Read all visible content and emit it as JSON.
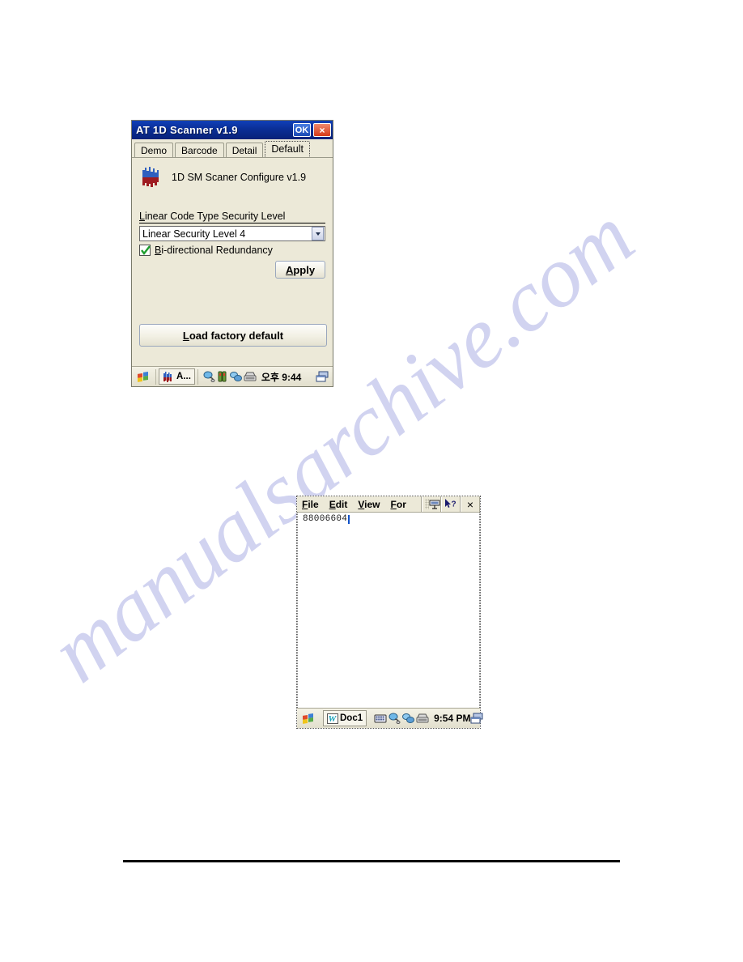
{
  "page": {
    "watermark": "manualsarchive.com",
    "background_color": "#ffffff",
    "rule_color": "#000000"
  },
  "scanner_window": {
    "title": "AT 1D Scanner v1.9",
    "titlebar_color": "#0a2e96",
    "ok_button": "OK",
    "close_button": "×",
    "tabs": [
      {
        "label": "Demo",
        "active": false
      },
      {
        "label": "Barcode",
        "active": false
      },
      {
        "label": "Detail",
        "active": false
      },
      {
        "label": "Default",
        "active": true
      }
    ],
    "brand_text": "1D SM Scaner Configure v1.9",
    "field_label": "Linear Code Type Security Level",
    "combo_value": "Linear Security Level 4",
    "checkbox": {
      "label": "Bi-directional Redundancy",
      "checked": true,
      "check_color": "#1e9e2e"
    },
    "apply_button": "Apply",
    "load_default_button": "Load factory default",
    "taskbar": {
      "task_item": "A...",
      "time": "오후 9:44"
    }
  },
  "wordpad_window": {
    "menus": [
      "File",
      "Edit",
      "View",
      "For"
    ],
    "close_button": "×",
    "document_text": "88006604",
    "taskbar": {
      "task_item": "Doc1",
      "time": "9:54 PM"
    }
  }
}
